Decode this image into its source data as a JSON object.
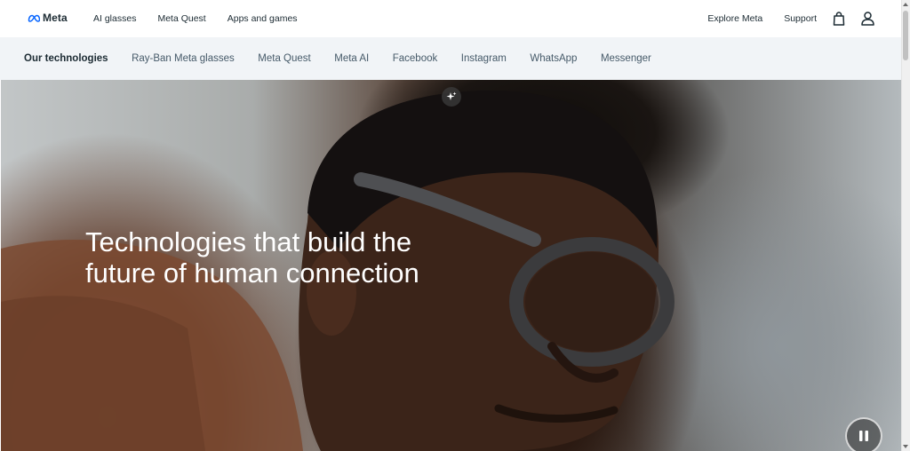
{
  "brand": {
    "name": "Meta",
    "icon": "meta-infinity-logo"
  },
  "topnav": {
    "left_links": [
      "AI glasses",
      "Meta Quest",
      "Apps and games"
    ],
    "right_links": [
      "Explore Meta",
      "Support"
    ],
    "icons": [
      "shopping-bag-icon",
      "account-icon"
    ]
  },
  "subnav": {
    "items": [
      "Our technologies",
      "Ray-Ban Meta glasses",
      "Meta Quest",
      "Meta AI",
      "Facebook",
      "Instagram",
      "WhatsApp",
      "Messenger"
    ],
    "active_index": 0
  },
  "hero": {
    "heading": "Technologies that build the future of human connection",
    "badge_icon": "sparkle-icon",
    "control_icon": "pause-icon"
  }
}
